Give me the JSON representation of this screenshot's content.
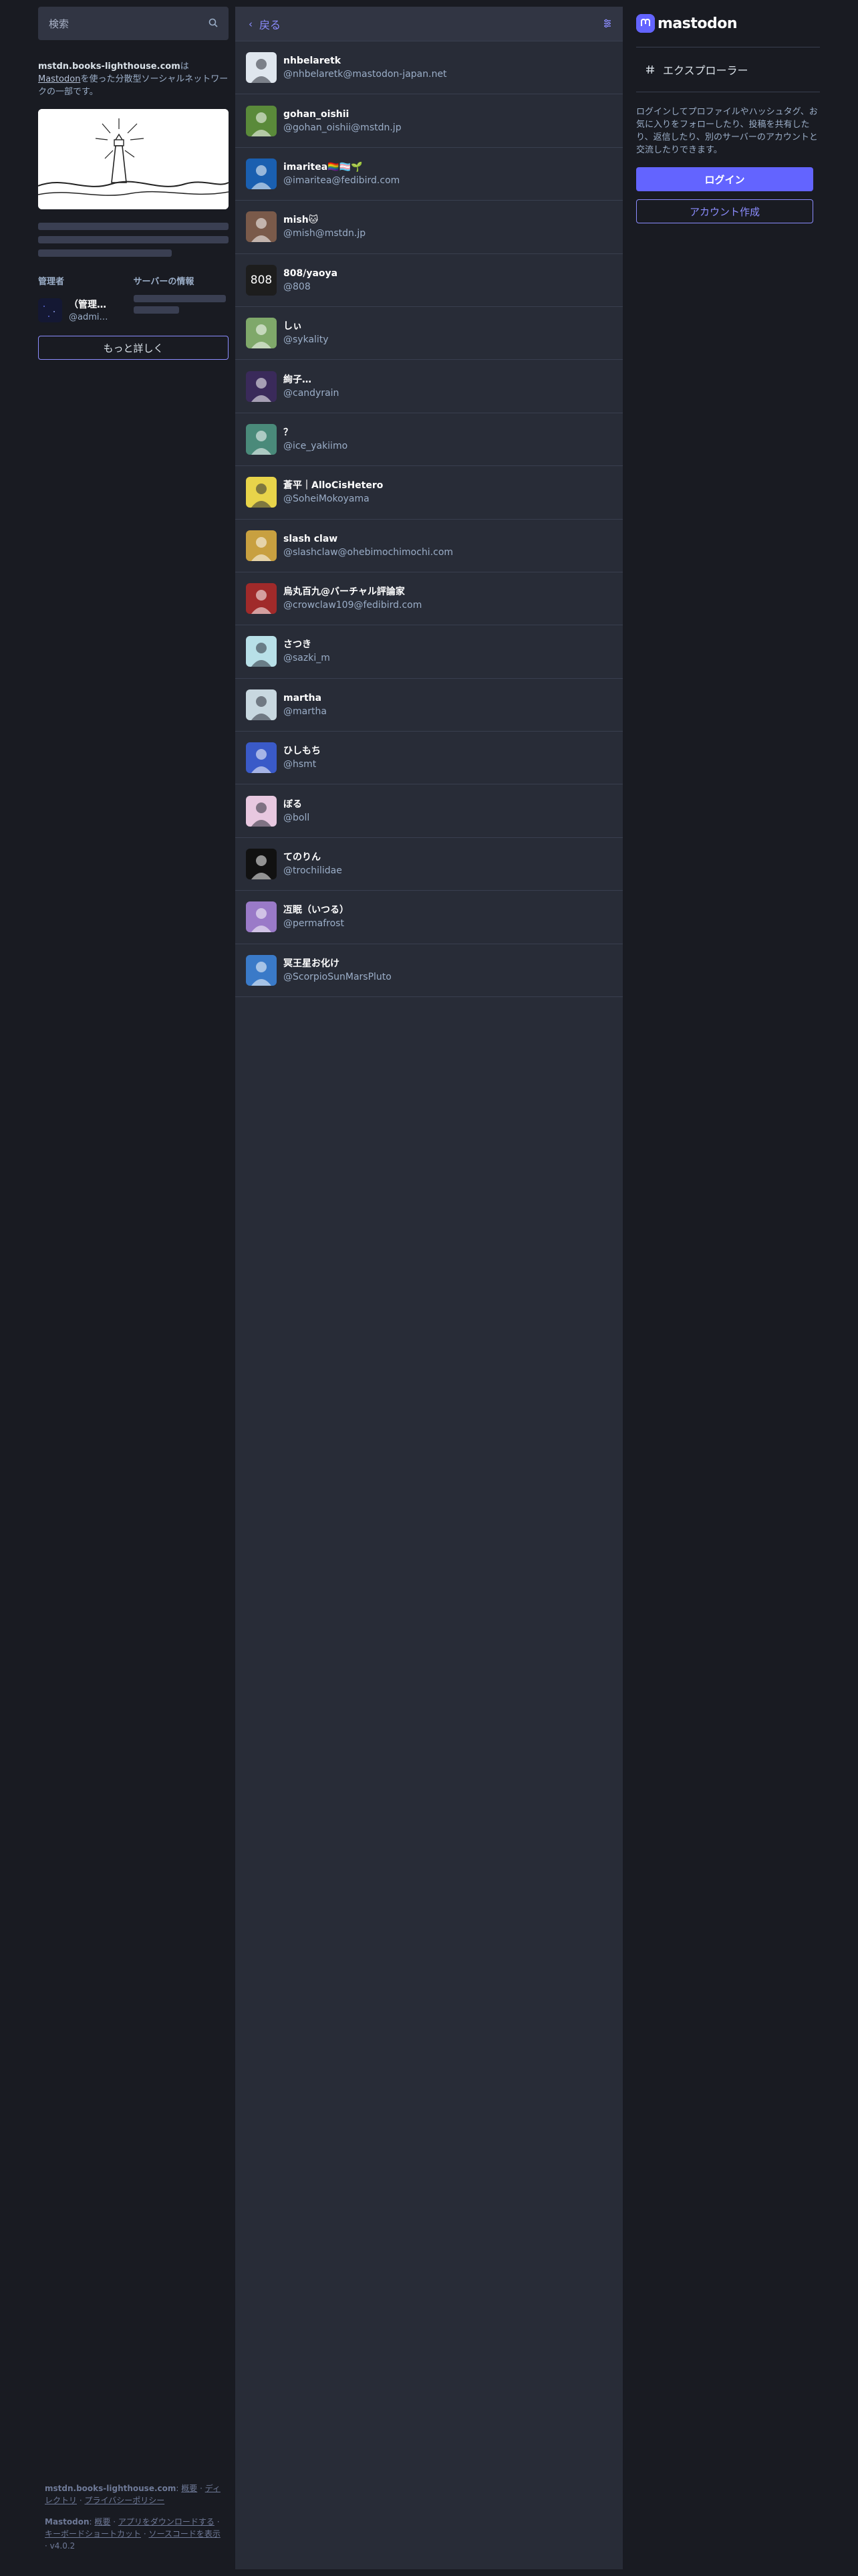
{
  "search": {
    "placeholder": "検索"
  },
  "server": {
    "domain": "mstdn.books-lighthouse.com",
    "desc_mid": "は",
    "mastodon_link": "Mastodon",
    "desc_end": "を使った分散型ソーシャルネットワークの一部です。",
    "admin_heading": "管理者",
    "info_heading": "サーバーの情報",
    "admin_name": "（管理…",
    "admin_handle": "@admi…",
    "more_button": "もっと詳しく"
  },
  "column": {
    "back_label": "戻る"
  },
  "accounts": [
    {
      "name": "nhbelaretk",
      "handle": "@nhbelaretk@mastodon-japan.net",
      "avatar_color": "#dfe6ee",
      "avatar_icon": "lighthouse"
    },
    {
      "name": "gohan_oishii",
      "handle": "@gohan_oishii@mstdn.jp",
      "avatar_color": "#5a8a3a",
      "avatar_icon": "food"
    },
    {
      "name": "imaritea🏳️‍🌈🏳️‍⚧️🌱",
      "handle": "@imaritea@fedibird.com",
      "avatar_color": "#1a5fb0",
      "avatar_icon": "anime"
    },
    {
      "name": "mish🐱",
      "handle": "@mish@mstdn.jp",
      "avatar_color": "#7a5a4a",
      "avatar_icon": "anime"
    },
    {
      "name": "808/yaoya",
      "handle": "@808",
      "avatar_color": "#1d1d1d",
      "avatar_text": "808"
    },
    {
      "name": "しぃ",
      "handle": "@sykality",
      "avatar_color": "#7fa86a",
      "avatar_icon": "anime"
    },
    {
      "name": "絢子…",
      "handle": "@candyrain",
      "avatar_color": "#3a2a5a",
      "avatar_icon": "dark"
    },
    {
      "name": "？",
      "handle": "@ice_yakiimo",
      "avatar_color": "#4a8a7a",
      "avatar_icon": "landscape"
    },
    {
      "name": "蒼平｜AlloCisHetero",
      "handle": "@SoheiMokoyama",
      "avatar_color": "#e8d44a",
      "avatar_icon": "person"
    },
    {
      "name": "slash claw",
      "handle": "@slashclaw@ohebimochimochi.com",
      "avatar_color": "#c8a040",
      "avatar_icon": "pattern"
    },
    {
      "name": "烏丸百九@バーチャル評論家",
      "handle": "@crowclaw109@fedibird.com",
      "avatar_color": "#a02a2a",
      "avatar_icon": "anime"
    },
    {
      "name": "さつき",
      "handle": "@sazki_m",
      "avatar_color": "#b8e0e8",
      "avatar_icon": "anime"
    },
    {
      "name": "martha",
      "handle": "@martha",
      "avatar_color": "#c8d8e0",
      "avatar_icon": "blank"
    },
    {
      "name": "ひしもち",
      "handle": "@hsmt",
      "avatar_color": "#3a5ac8",
      "avatar_icon": "face"
    },
    {
      "name": "ぼる",
      "handle": "@boll",
      "avatar_color": "#e8c8e0",
      "avatar_icon": "anime"
    },
    {
      "name": "てのりん",
      "handle": "@trochilidae",
      "avatar_color": "#111111",
      "avatar_icon": "symbol"
    },
    {
      "name": "冱眠（いつる）",
      "handle": "@permafrost",
      "avatar_color": "#9a7ac8",
      "avatar_icon": "sky"
    },
    {
      "name": "冥王星お化け",
      "handle": "@ScorpioSunMarsPluto",
      "avatar_color": "#3a7ac8",
      "avatar_icon": "ghost"
    }
  ],
  "right": {
    "logo_text": "mastodon",
    "explore_label": "エクスプローラー",
    "login_desc": "ログインしてプロファイルやハッシュタグ、お気に入りをフォローしたり、投稿を共有したり、返信したり、別のサーバーのアカウントと交流したりできます。",
    "login_button": "ログイン",
    "signup_button": "アカウント作成"
  },
  "footer": {
    "server_domain": "mstdn.books-lighthouse.com",
    "about": "概要",
    "directory": "ディレクトリ",
    "privacy": "プライバシーポリシー",
    "mastodon_label": "Mastodon",
    "mastodon_about": "概要",
    "get_app": "アプリをダウンロードする",
    "shortcuts": "キーボードショートカット",
    "source": "ソースコードを表示",
    "version": "v4.0.2"
  },
  "colors": {
    "accent": "#6364ff",
    "link": "#8c8dff",
    "bg": "#191b22",
    "panel": "#282c37"
  }
}
